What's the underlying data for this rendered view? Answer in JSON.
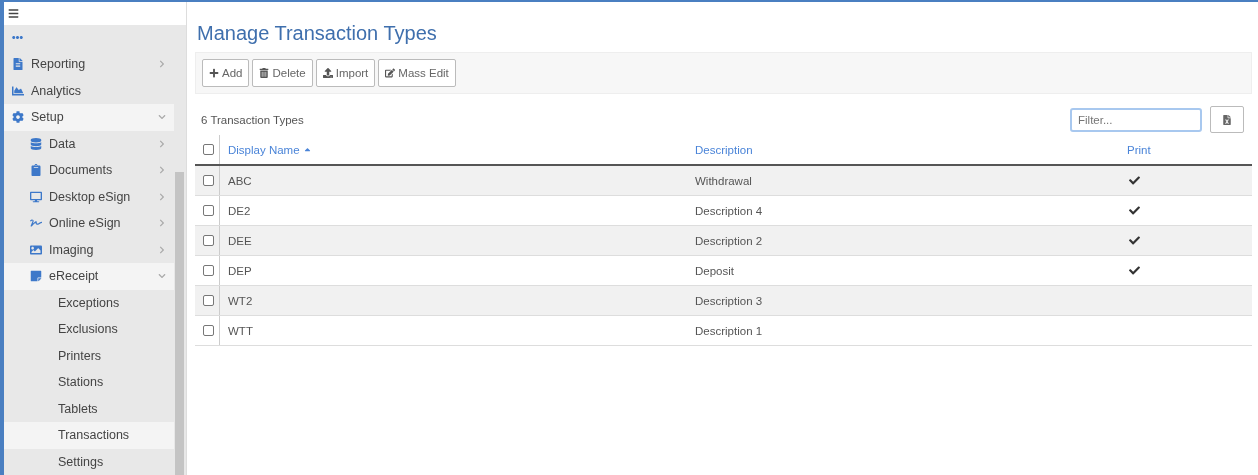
{
  "sidebar": {
    "items": [
      {
        "label": "Reporting",
        "kind": "group",
        "expanded": false,
        "selected": false
      },
      {
        "label": "Analytics",
        "kind": "link",
        "selected": false
      },
      {
        "label": "Setup",
        "kind": "group",
        "expanded": true,
        "selected": true,
        "children": [
          {
            "label": "Data",
            "kind": "group",
            "expanded": false,
            "selected": false
          },
          {
            "label": "Documents",
            "kind": "group",
            "expanded": false,
            "selected": false
          },
          {
            "label": "Desktop eSign",
            "kind": "group",
            "expanded": false,
            "selected": false
          },
          {
            "label": "Online eSign",
            "kind": "group",
            "expanded": false,
            "selected": false
          },
          {
            "label": "Imaging",
            "kind": "group",
            "expanded": false,
            "selected": false
          },
          {
            "label": "eReceipt",
            "kind": "group",
            "expanded": true,
            "selected": true,
            "children": [
              {
                "label": "Exceptions",
                "selected": false
              },
              {
                "label": "Exclusions",
                "selected": false
              },
              {
                "label": "Printers",
                "selected": false
              },
              {
                "label": "Stations",
                "selected": false
              },
              {
                "label": "Tablets",
                "selected": false
              },
              {
                "label": "Transactions",
                "selected": true
              },
              {
                "label": "Settings",
                "selected": false
              }
            ]
          }
        ]
      }
    ]
  },
  "page": {
    "title": "Manage Transaction Types"
  },
  "toolbar": [
    {
      "label": "Add"
    },
    {
      "label": "Delete"
    },
    {
      "label": "Import"
    },
    {
      "label": "Mass Edit"
    }
  ],
  "count": "6 Transaction Types",
  "filter": {
    "placeholder": "Filter..."
  },
  "table": {
    "all_checked": false,
    "columns": [
      {
        "label": "Display Name",
        "sorted": true
      },
      {
        "label": "Description",
        "sorted": false
      },
      {
        "label": "Print",
        "sorted": false
      }
    ],
    "rows": [
      {
        "name": "ABC",
        "description": "Withdrawal",
        "print": true,
        "checked": false
      },
      {
        "name": "DE2",
        "description": "Description 4",
        "print": true,
        "checked": false
      },
      {
        "name": "DEE",
        "description": "Description 2",
        "print": true,
        "checked": false
      },
      {
        "name": "DEP",
        "description": "Deposit",
        "print": true,
        "checked": false
      },
      {
        "name": "WT2",
        "description": "Description 3",
        "print": false,
        "checked": false
      },
      {
        "name": "WTT",
        "description": "Description 1",
        "print": false,
        "checked": false
      }
    ]
  }
}
